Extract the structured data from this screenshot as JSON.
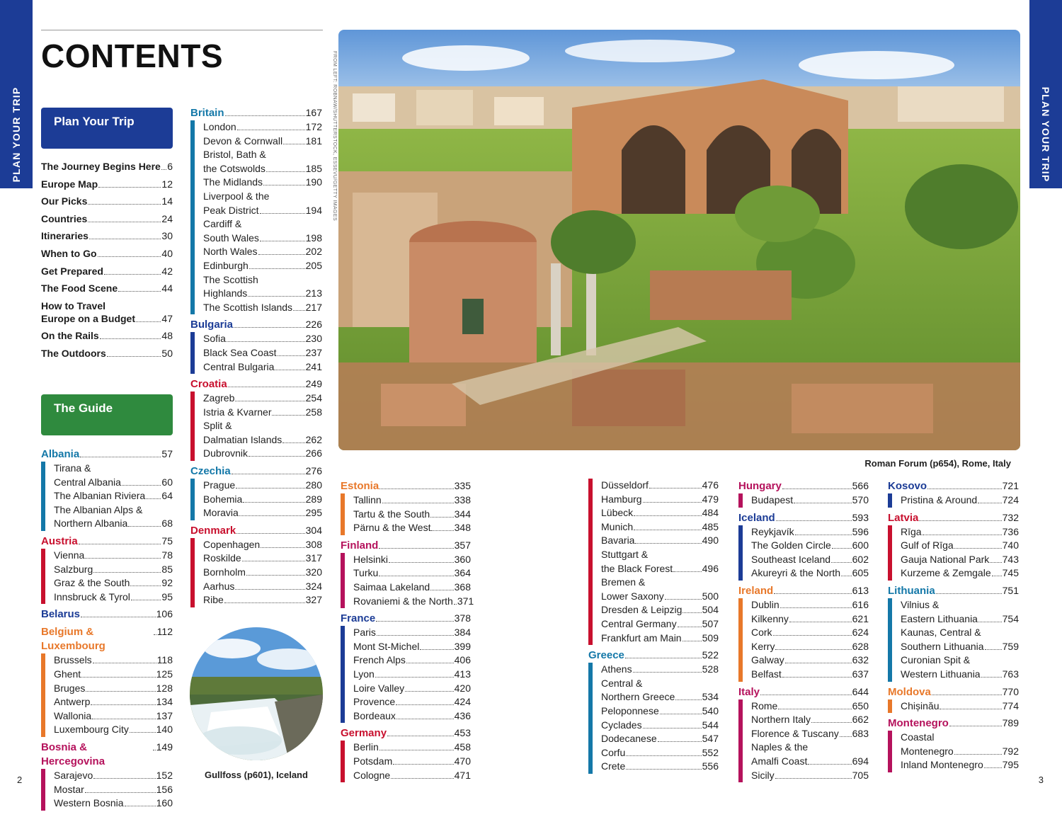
{
  "tabs": {
    "left": "PLAN YOUR TRIP",
    "right": "PLAN YOUR TRIP"
  },
  "title": "CONTENTS",
  "photo_credit": "FROM LEFT: ROBNAW/SHUTTERSTOCK, ESSEVU/GETTY IMAGES",
  "plan_section": {
    "label": "Plan Your Trip",
    "items": [
      {
        "label": "The Journey Begins Here",
        "page": "6"
      },
      {
        "label": "Europe Map",
        "page": "12"
      },
      {
        "label": "Our Picks",
        "page": "14"
      },
      {
        "label": "Countries",
        "page": "24"
      },
      {
        "label": "Itineraries",
        "page": "30"
      },
      {
        "label": "When to Go",
        "page": "40"
      },
      {
        "label": "Get Prepared",
        "page": "42"
      },
      {
        "label": "The Food Scene",
        "page": "44"
      },
      {
        "label_line1": "How to Travel",
        "label": "Europe on a Budget",
        "page": "47"
      },
      {
        "label": "On the Rails",
        "page": "48"
      },
      {
        "label": "The Outdoors",
        "page": "50"
      }
    ]
  },
  "guide_section": {
    "label": "The Guide"
  },
  "columns": [
    [
      {
        "name": "Albania",
        "page": "57",
        "color": "#1478a8",
        "cities": [
          {
            "line1": "Tirana &",
            "label": "Central Albania",
            "page": "60"
          },
          {
            "label": "The Albanian Riviera",
            "page": "64"
          },
          {
            "line1": "The Albanian Alps &",
            "label": "Northern Albania",
            "page": "68"
          }
        ]
      },
      {
        "name": "Austria",
        "page": "75",
        "color": "#c8102e",
        "cities": [
          {
            "label": "Vienna",
            "page": "78"
          },
          {
            "label": "Salzburg",
            "page": "85"
          },
          {
            "label": "Graz & the South",
            "page": "92"
          },
          {
            "label": "Innsbruck & Tyrol",
            "page": "95"
          }
        ]
      },
      {
        "name": "Belarus",
        "page": "106",
        "color": "#1c3c96",
        "cities": []
      },
      {
        "name": "Belgium & Luxembourg",
        "page": "112",
        "color": "#e8782a",
        "cities": [
          {
            "label": "Brussels",
            "page": "118"
          },
          {
            "label": "Ghent",
            "page": "125"
          },
          {
            "label": "Bruges",
            "page": "128"
          },
          {
            "label": "Antwerp",
            "page": "134"
          },
          {
            "label": "Wallonia",
            "page": "137"
          },
          {
            "label": "Luxembourg City",
            "page": "140"
          }
        ]
      },
      {
        "name": "Bosnia & Hercegovina",
        "page": "149",
        "color": "#b5125c",
        "cities": [
          {
            "label": "Sarajevo",
            "page": "152"
          },
          {
            "label": "Mostar",
            "page": "156"
          },
          {
            "label": "Western Bosnia",
            "page": "160"
          }
        ]
      }
    ],
    [
      {
        "name": "Britain",
        "page": "167",
        "color": "#1478a8",
        "cities": [
          {
            "label": "London",
            "page": "172"
          },
          {
            "label": "Devon & Cornwall",
            "page": "181"
          },
          {
            "line1": "Bristol, Bath &",
            "label": "the Cotswolds",
            "page": "185"
          },
          {
            "label": "The Midlands",
            "page": "190"
          },
          {
            "line1": "Liverpool & the",
            "label": "Peak District",
            "page": "194"
          },
          {
            "line1": "Cardiff &",
            "label": "South Wales",
            "page": "198"
          },
          {
            "label": "North Wales",
            "page": "202"
          },
          {
            "label": "Edinburgh",
            "page": "205"
          },
          {
            "line1": "The Scottish",
            "label": "Highlands",
            "page": "213"
          },
          {
            "label": "The Scottish Islands",
            "page": "217"
          }
        ]
      },
      {
        "name": "Bulgaria",
        "page": "226",
        "color": "#1c3c96",
        "cities": [
          {
            "label": "Sofia",
            "page": "230"
          },
          {
            "label": "Black Sea Coast",
            "page": "237"
          },
          {
            "label": "Central Bulgaria",
            "page": "241"
          }
        ]
      },
      {
        "name": "Croatia",
        "page": "249",
        "color": "#c8102e",
        "cities": [
          {
            "label": "Zagreb",
            "page": "254"
          },
          {
            "label": "Istria & Kvarner",
            "page": "258"
          },
          {
            "line1": "Split &",
            "label": "Dalmatian Islands",
            "page": "262"
          },
          {
            "label": "Dubrovnik",
            "page": "266"
          }
        ]
      },
      {
        "name": "Czechia",
        "page": "276",
        "color": "#1478a8",
        "cities": [
          {
            "label": "Prague",
            "page": "280"
          },
          {
            "label": "Bohemia",
            "page": "289"
          },
          {
            "label": "Moravia",
            "page": "295"
          }
        ]
      },
      {
        "name": "Denmark",
        "page": "304",
        "color": "#c8102e",
        "cities": [
          {
            "label": "Copenhagen",
            "page": "308"
          },
          {
            "label": "Roskilde",
            "page": "317"
          },
          {
            "label": "Bornholm",
            "page": "320"
          },
          {
            "label": "Aarhus",
            "page": "324"
          },
          {
            "label": "Ribe",
            "page": "327"
          }
        ]
      }
    ],
    [
      {
        "name": "Estonia",
        "page": "335",
        "color": "#e8782a",
        "cities": [
          {
            "label": "Tallinn",
            "page": "338"
          },
          {
            "label": "Tartu & the South",
            "page": "344"
          },
          {
            "label": "Pärnu & the West",
            "page": "348"
          }
        ]
      },
      {
        "name": "Finland",
        "page": "357",
        "color": "#b5125c",
        "cities": [
          {
            "label": "Helsinki",
            "page": "360"
          },
          {
            "label": "Turku",
            "page": "364"
          },
          {
            "label": "Saimaa Lakeland",
            "page": "368"
          },
          {
            "label": "Rovaniemi & the North",
            "page": "371"
          }
        ]
      },
      {
        "name": "France",
        "page": "378",
        "color": "#1c3c96",
        "cities": [
          {
            "label": "Paris",
            "page": "384"
          },
          {
            "label": "Mont St-Michel",
            "page": "399"
          },
          {
            "label": "French Alps",
            "page": "406"
          },
          {
            "label": "Lyon",
            "page": "413"
          },
          {
            "label": "Loire Valley",
            "page": "420"
          },
          {
            "label": "Provence",
            "page": "424"
          },
          {
            "label": "Bordeaux",
            "page": "436"
          }
        ]
      },
      {
        "name": "Germany",
        "page": "453",
        "color": "#c8102e",
        "cities": [
          {
            "label": "Berlin",
            "page": "458"
          },
          {
            "label": "Potsdam",
            "page": "470"
          },
          {
            "label": "Cologne",
            "page": "471"
          }
        ]
      }
    ],
    [
      {
        "name": "",
        "page": "",
        "color": "#c8102e",
        "cities": [
          {
            "label": "Düsseldorf",
            "page": "476"
          },
          {
            "label": "Hamburg",
            "page": "479"
          },
          {
            "label": "Lübeck",
            "page": "484"
          },
          {
            "label": "Munich",
            "page": "485"
          },
          {
            "label": "Bavaria",
            "page": "490"
          },
          {
            "line1": "Stuttgart &",
            "label": "the Black Forest",
            "page": "496"
          },
          {
            "line1": "Bremen &",
            "label": "Lower Saxony",
            "page": "500"
          },
          {
            "label": "Dresden & Leipzig",
            "page": "504"
          },
          {
            "label": "Central Germany",
            "page": "507"
          },
          {
            "label": "Frankfurt am Main",
            "page": "509"
          }
        ]
      },
      {
        "name": "Greece",
        "page": "522",
        "color": "#1478a8",
        "cities": [
          {
            "label": "Athens",
            "page": "528"
          },
          {
            "line1": "Central &",
            "label": "Northern Greece",
            "page": "534"
          },
          {
            "label": "Peloponnese",
            "page": "540"
          },
          {
            "label": "Cyclades",
            "page": "544"
          },
          {
            "label": "Dodecanese",
            "page": "547"
          },
          {
            "label": "Corfu",
            "page": "552"
          },
          {
            "label": "Crete",
            "page": "556"
          }
        ]
      }
    ],
    [
      {
        "name": "Hungary",
        "page": "566",
        "color": "#b5125c",
        "cities": [
          {
            "label": "Budapest",
            "page": "570"
          }
        ]
      },
      {
        "name": "Iceland",
        "page": "593",
        "color": "#1c3c96",
        "cities": [
          {
            "label": "Reykjavík",
            "page": "596"
          },
          {
            "label": "The Golden Circle",
            "page": "600"
          },
          {
            "label": "Southeast Iceland",
            "page": "602"
          },
          {
            "label": "Akureyri & the North",
            "page": "605"
          }
        ]
      },
      {
        "name": "Ireland",
        "page": "613",
        "color": "#e8782a",
        "cities": [
          {
            "label": "Dublin",
            "page": "616"
          },
          {
            "label": "Kilkenny",
            "page": "621"
          },
          {
            "label": "Cork",
            "page": "624"
          },
          {
            "label": "Kerry",
            "page": "628"
          },
          {
            "label": "Galway",
            "page": "632"
          },
          {
            "label": "Belfast",
            "page": "637"
          }
        ]
      },
      {
        "name": "Italy",
        "page": "644",
        "color": "#b5125c",
        "cities": [
          {
            "label": "Rome",
            "page": "650"
          },
          {
            "label": "Northern Italy",
            "page": "662"
          },
          {
            "label": "Florence & Tuscany",
            "page": "683"
          },
          {
            "line1": "Naples & the",
            "label": "Amalfi Coast",
            "page": "694"
          },
          {
            "label": "Sicily",
            "page": "705"
          }
        ]
      }
    ],
    [
      {
        "name": "Kosovo",
        "page": "721",
        "color": "#1c3c96",
        "cities": [
          {
            "label": "Pristina & Around",
            "page": "724"
          }
        ]
      },
      {
        "name": "Latvia",
        "page": "732",
        "color": "#c8102e",
        "cities": [
          {
            "label": "Rīga",
            "page": "736"
          },
          {
            "label": "Gulf of Rīga",
            "page": "740"
          },
          {
            "label": "Gauja National Park",
            "page": "743"
          },
          {
            "label": "Kurzeme & Zemgale",
            "page": "745"
          }
        ]
      },
      {
        "name": "Lithuania",
        "page": "751",
        "color": "#1478a8",
        "cities": [
          {
            "line1": "Vilnius &",
            "label": "Eastern Lithuania",
            "page": "754"
          },
          {
            "line1": "Kaunas, Central &",
            "label": "Southern Lithuania",
            "page": "759"
          },
          {
            "line1": "Curonian Spit &",
            "label": "Western Lithuania",
            "page": "763"
          }
        ]
      },
      {
        "name": "Moldova",
        "page": "770",
        "color": "#e8782a",
        "cities": [
          {
            "label": "Chișinău",
            "page": "774"
          }
        ]
      },
      {
        "name": "Montenegro",
        "page": "789",
        "color": "#b5125c",
        "cities": [
          {
            "line1": "Coastal",
            "label": "Montenegro",
            "page": "792"
          },
          {
            "label": "Inland Montenegro",
            "page": "795"
          }
        ]
      }
    ]
  ],
  "main_photo_caption": "Roman Forum (p654), Rome, Italy",
  "circle_photo_caption": "Gullfoss (p601), Iceland",
  "page_numbers": {
    "left": "2",
    "right": "3"
  }
}
